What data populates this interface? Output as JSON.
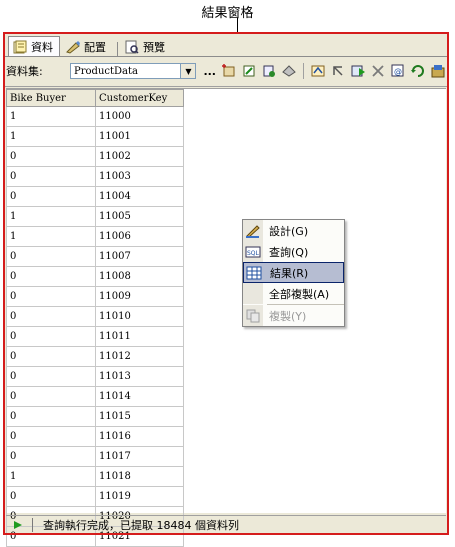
{
  "annotation": {
    "title": "結果窗格"
  },
  "tabs": [
    {
      "label": "資料",
      "icon": "data-icon",
      "active": true
    },
    {
      "label": "配置",
      "icon": "layout-icon",
      "active": false
    },
    {
      "label": "預覽",
      "icon": "preview-icon",
      "active": false
    }
  ],
  "toolbar": {
    "dataset_label": "資料集:",
    "dataset_value": "ProductData",
    "dots": "...",
    "icons": [
      "new-dataset-icon",
      "edit-icon",
      "refresh-fields-icon",
      "delete-dataset-icon",
      "generic-query-icon",
      "back-icon",
      "run-icon",
      "cancel-icon",
      "command-type-icon",
      "refresh-icon",
      "query-designer-icon"
    ]
  },
  "grid": {
    "columns": [
      "Bike Buyer",
      "CustomerKey"
    ],
    "rows": [
      [
        "1",
        "11000"
      ],
      [
        "1",
        "11001"
      ],
      [
        "0",
        "11002"
      ],
      [
        "0",
        "11003"
      ],
      [
        "0",
        "11004"
      ],
      [
        "1",
        "11005"
      ],
      [
        "1",
        "11006"
      ],
      [
        "0",
        "11007"
      ],
      [
        "0",
        "11008"
      ],
      [
        "0",
        "11009"
      ],
      [
        "0",
        "11010"
      ],
      [
        "0",
        "11011"
      ],
      [
        "0",
        "11012"
      ],
      [
        "0",
        "11013"
      ],
      [
        "0",
        "11014"
      ],
      [
        "0",
        "11015"
      ],
      [
        "0",
        "11016"
      ],
      [
        "0",
        "11017"
      ],
      [
        "1",
        "11018"
      ],
      [
        "0",
        "11019"
      ],
      [
        "0",
        "11020"
      ],
      [
        "0",
        "11021"
      ]
    ]
  },
  "context_menu": {
    "items": [
      {
        "label": "設計(G)",
        "icon": "design-icon",
        "highlighted": false,
        "disabled": false
      },
      {
        "label": "查詢(Q)",
        "icon": "sql-icon",
        "highlighted": false,
        "disabled": false
      },
      {
        "label": "結果(R)",
        "icon": "results-grid-icon",
        "highlighted": true,
        "disabled": false
      },
      {
        "label": "全部複製(A)",
        "icon": "",
        "highlighted": false,
        "disabled": false
      },
      {
        "label": "複製(Y)",
        "icon": "copy-icon",
        "highlighted": false,
        "disabled": true
      }
    ]
  },
  "status": {
    "message": "查詢執行完成，已提取 18484 個資料列"
  },
  "colors": {
    "annotation_frame": "#d51c1c",
    "menu_highlight": "#b6bdd2",
    "run_arrow": "#1f9a1f"
  }
}
